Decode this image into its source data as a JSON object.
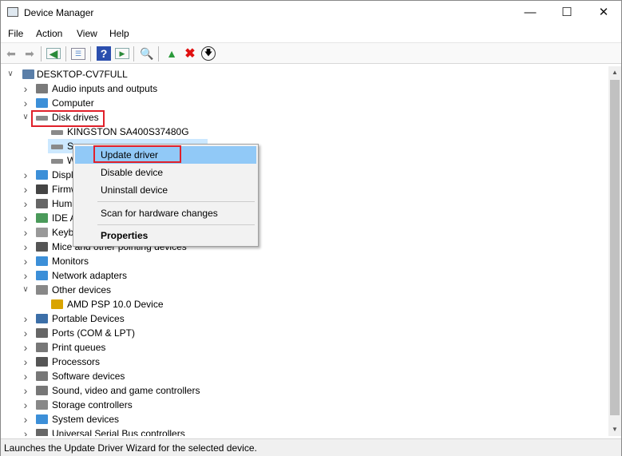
{
  "window": {
    "title": "Device Manager",
    "controls": [
      "minimize",
      "maximize",
      "close"
    ]
  },
  "menu": [
    "File",
    "Action",
    "View",
    "Help"
  ],
  "toolbar": [
    "back-icon",
    "forward-icon",
    "show-hide-console-tree-icon",
    "properties-icon",
    "help-icon",
    "show-action-pane-icon",
    "scan-hardware-icon",
    "update-driver-icon",
    "uninstall-icon",
    "disable-icon"
  ],
  "tree": [
    {
      "label": "DESKTOP-CV7FULL",
      "level": 0,
      "expanded": true,
      "icon": "computer-icon",
      "color": "#5a7ea8"
    },
    {
      "label": "Audio inputs and outputs",
      "level": 1,
      "expanded": false,
      "icon": "speaker-icon",
      "color": "#7a7a7a"
    },
    {
      "label": "Computer",
      "level": 1,
      "expanded": false,
      "icon": "monitor-icon",
      "color": "#3c8fd8"
    },
    {
      "label": "Disk drives",
      "level": 1,
      "expanded": true,
      "icon": "disk-icon",
      "color": "#8a8a8a"
    },
    {
      "label": "KINGSTON SA400S37480G",
      "level": 2,
      "icon": "disk-icon",
      "color": "#8a8a8a"
    },
    {
      "label": "S",
      "level": 2,
      "icon": "disk-icon",
      "color": "#8a8a8a",
      "selected": true
    },
    {
      "label": "W",
      "level": 2,
      "icon": "disk-icon",
      "color": "#8a8a8a"
    },
    {
      "label": "Display adapters",
      "level": 1,
      "expanded": false,
      "icon": "display-adapter-icon",
      "color": "#3c8fd8"
    },
    {
      "label": "Firmware",
      "level": 1,
      "expanded": false,
      "icon": "chip-icon",
      "color": "#444"
    },
    {
      "label": "Human Interface Devices",
      "level": 1,
      "expanded": false,
      "icon": "hid-icon",
      "color": "#666"
    },
    {
      "label": "IDE ATA/ATAPI controllers",
      "level": 1,
      "expanded": false,
      "icon": "controller-icon",
      "color": "#4a9a5a"
    },
    {
      "label": "Keyboards",
      "level": 1,
      "expanded": false,
      "icon": "keyboard-icon",
      "color": "#999"
    },
    {
      "label": "Mice and other pointing devices",
      "level": 1,
      "expanded": false,
      "icon": "mouse-icon",
      "color": "#555"
    },
    {
      "label": "Monitors",
      "level": 1,
      "expanded": false,
      "icon": "monitor-icon",
      "color": "#3c8fd8"
    },
    {
      "label": "Network adapters",
      "level": 1,
      "expanded": false,
      "icon": "network-icon",
      "color": "#3c8fd8"
    },
    {
      "label": "Other devices",
      "level": 1,
      "expanded": true,
      "icon": "unknown-device-icon",
      "color": "#888"
    },
    {
      "label": "AMD PSP 10.0 Device",
      "level": 2,
      "icon": "warning-device-icon",
      "color": "#d9a400"
    },
    {
      "label": "Portable Devices",
      "level": 1,
      "expanded": false,
      "icon": "portable-icon",
      "color": "#3c6fa8"
    },
    {
      "label": "Ports (COM & LPT)",
      "level": 1,
      "expanded": false,
      "icon": "port-icon",
      "color": "#666"
    },
    {
      "label": "Print queues",
      "level": 1,
      "expanded": false,
      "icon": "printer-icon",
      "color": "#777"
    },
    {
      "label": "Processors",
      "level": 1,
      "expanded": false,
      "icon": "processor-icon",
      "color": "#555"
    },
    {
      "label": "Software devices",
      "level": 1,
      "expanded": false,
      "icon": "software-icon",
      "color": "#777"
    },
    {
      "label": "Sound, video and game controllers",
      "level": 1,
      "expanded": false,
      "icon": "sound-icon",
      "color": "#777"
    },
    {
      "label": "Storage controllers",
      "level": 1,
      "expanded": false,
      "icon": "storage-icon",
      "color": "#888"
    },
    {
      "label": "System devices",
      "level": 1,
      "expanded": false,
      "icon": "system-icon",
      "color": "#3c8fd8"
    },
    {
      "label": "Universal Serial Bus controllers",
      "level": 1,
      "expanded": false,
      "icon": "usb-icon",
      "color": "#666"
    }
  ],
  "context_menu": {
    "items": [
      "Update driver",
      "Disable device",
      "Uninstall device",
      "Scan for hardware changes",
      "Properties"
    ],
    "highlighted": "Update driver"
  },
  "status": "Launches the Update Driver Wizard for the selected device.",
  "colors": {
    "highlight": "#91c9f7",
    "annotation": "#e0202a",
    "selection": "#cce8ff"
  }
}
